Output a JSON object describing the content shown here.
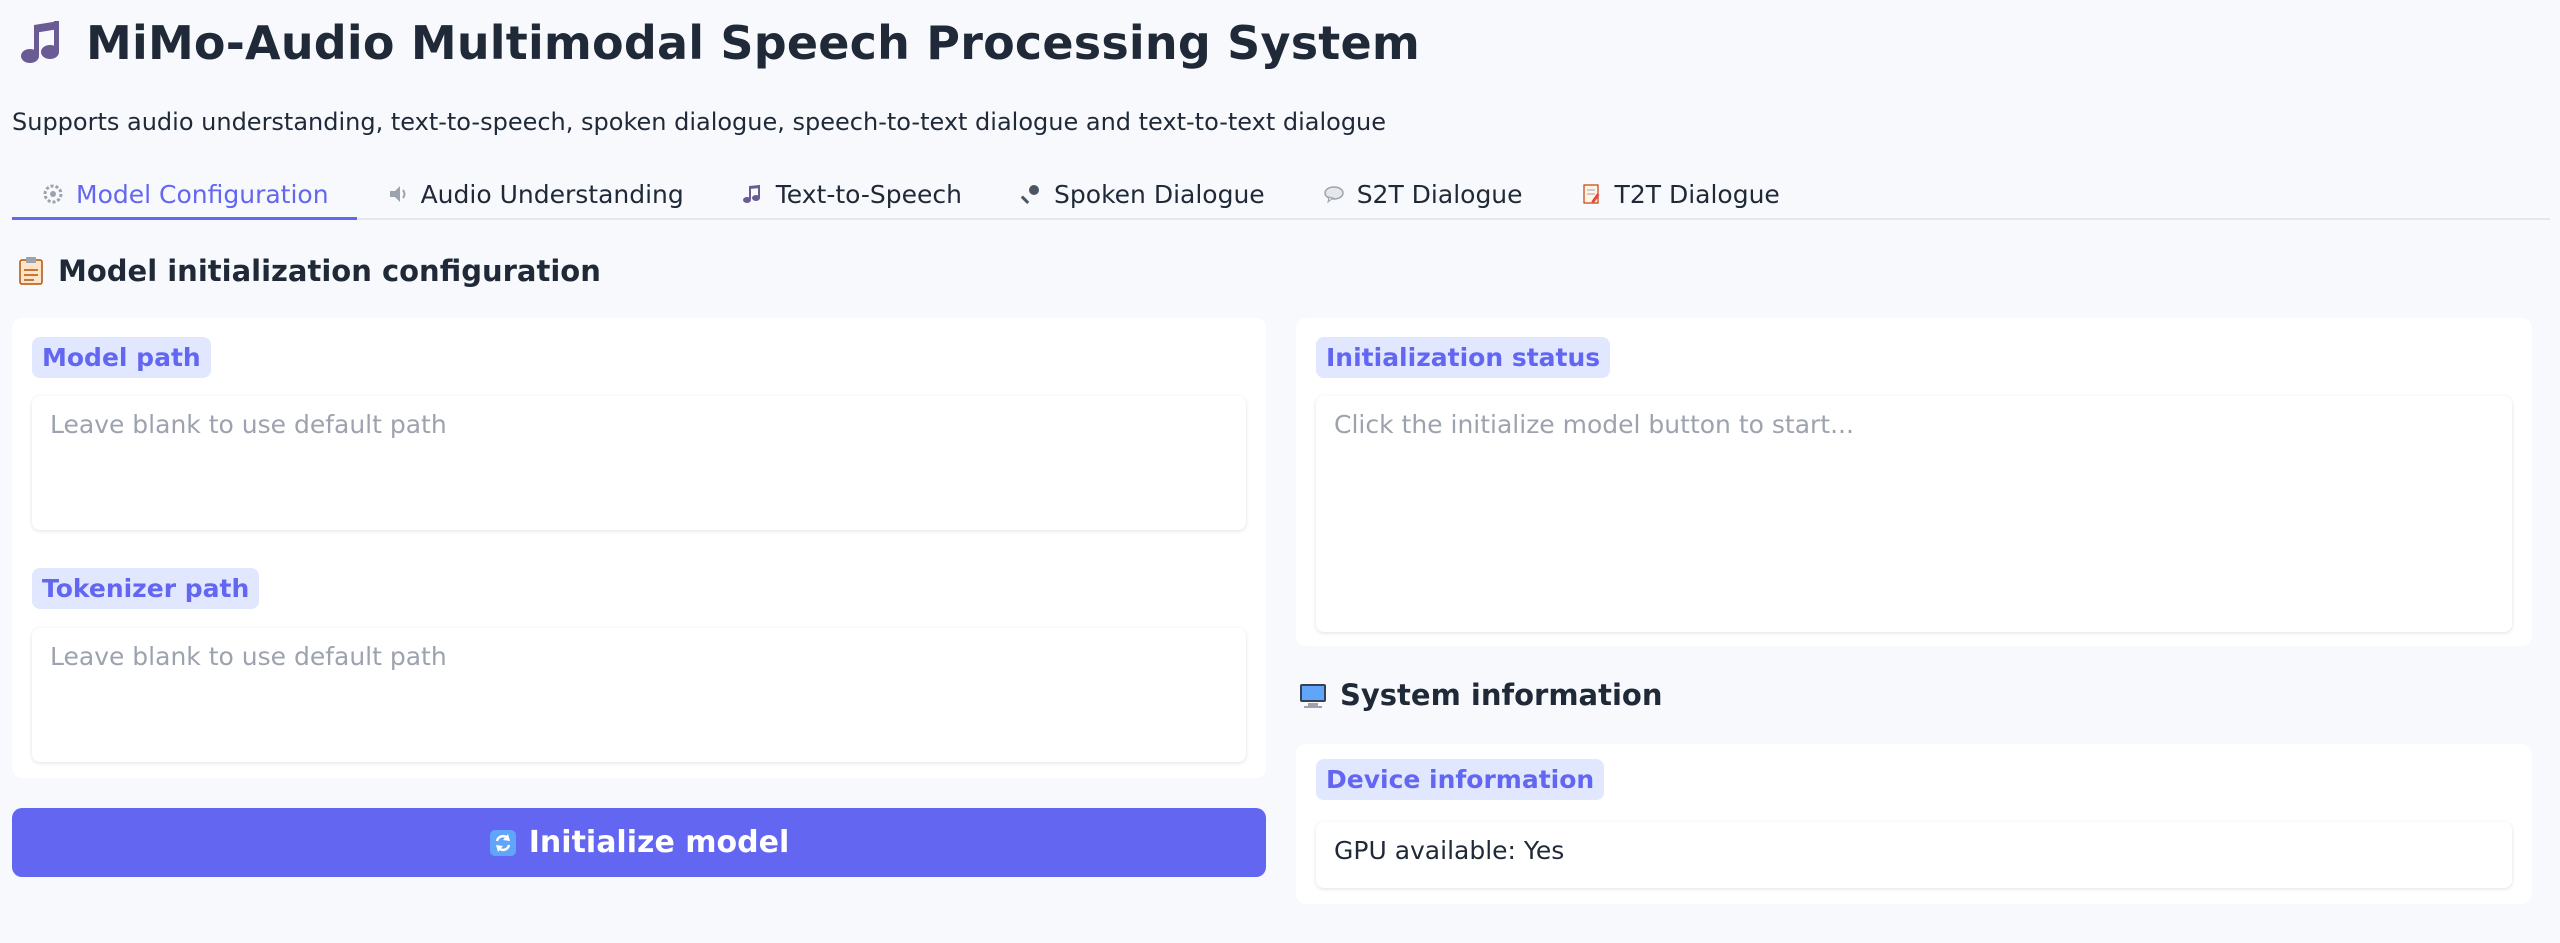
{
  "header": {
    "title": "MiMo-Audio Multimodal Speech Processing System",
    "subtitle": "Supports audio understanding, text-to-speech, spoken dialogue, speech-to-text dialogue and text-to-text dialogue",
    "title_icon": "music-note-icon"
  },
  "tabs": [
    {
      "label": "Model Configuration",
      "icon": "gear-icon",
      "active": true
    },
    {
      "label": "Audio Understanding",
      "icon": "speaker-icon",
      "active": false
    },
    {
      "label": "Text-to-Speech",
      "icon": "music-note-icon",
      "active": false
    },
    {
      "label": "Spoken Dialogue",
      "icon": "microphone-icon",
      "active": false
    },
    {
      "label": "S2T Dialogue",
      "icon": "speech-bubble-icon",
      "active": false
    },
    {
      "label": "T2T Dialogue",
      "icon": "memo-icon",
      "active": false
    }
  ],
  "config": {
    "section_title": "Model initialization configuration",
    "section_icon": "clipboard-icon",
    "model_path": {
      "label": "Model path",
      "value": "",
      "placeholder": "Leave blank to use default path"
    },
    "tokenizer_path": {
      "label": "Tokenizer path",
      "value": "",
      "placeholder": "Leave blank to use default path"
    },
    "init_button": {
      "label": "Initialize model",
      "icon": "refresh-icon"
    }
  },
  "status": {
    "label": "Initialization status",
    "placeholder": "Click the initialize model button to start..."
  },
  "system": {
    "section_title": "System information",
    "section_icon": "computer-icon",
    "device_label": "Device information",
    "device_value": "GPU available: Yes"
  },
  "colors": {
    "accent": "#6366f1",
    "label_bg": "#e0e7ff",
    "page_bg": "#f7f9fc"
  }
}
